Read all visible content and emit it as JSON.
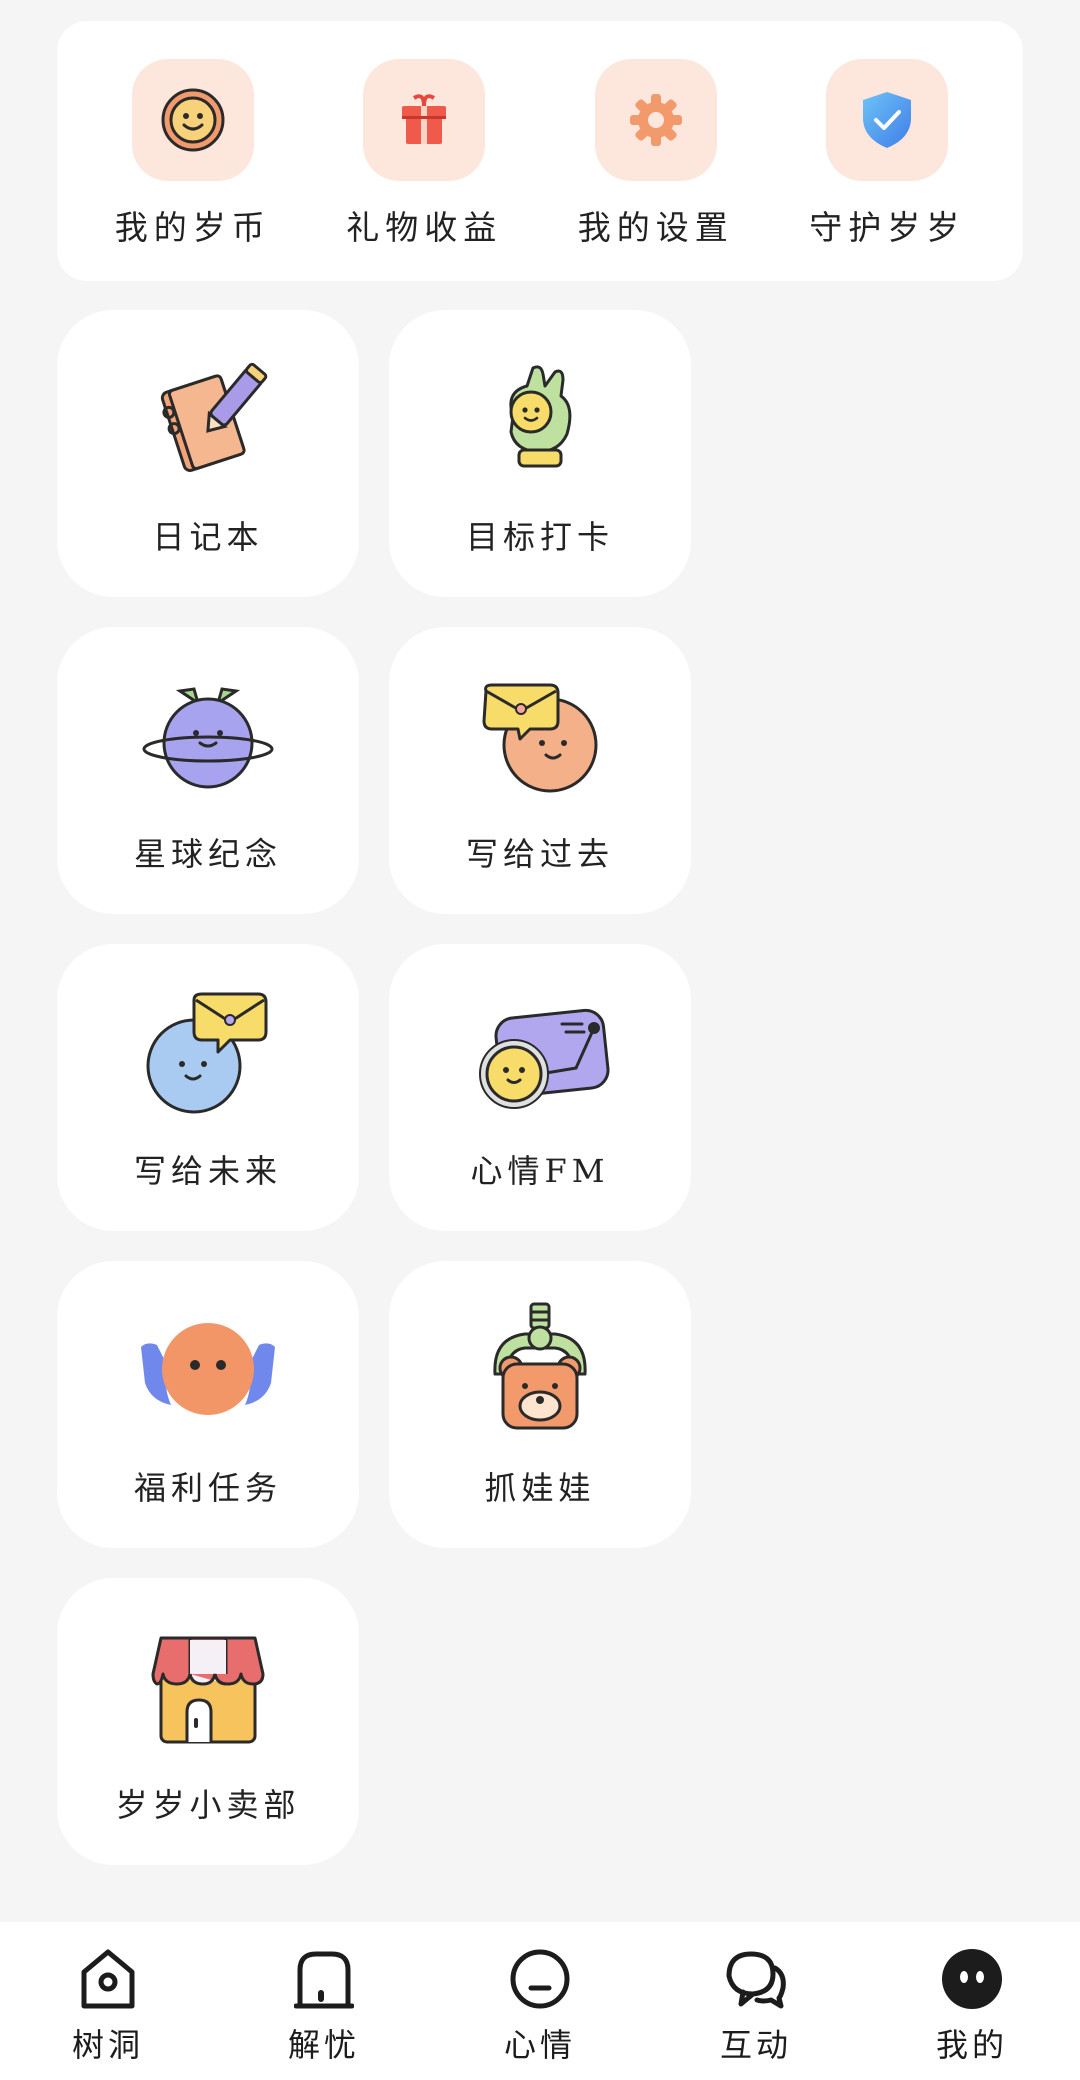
{
  "quick_panel": {
    "items": [
      {
        "label": "我的岁币",
        "icon": "smiley-coin-icon"
      },
      {
        "label": "礼物收益",
        "icon": "gift-icon"
      },
      {
        "label": "我的设置",
        "icon": "gear-icon"
      },
      {
        "label": "守护岁岁",
        "icon": "shield-check-icon"
      }
    ],
    "icon_bg_color": "#fde7dc"
  },
  "features": [
    {
      "label": "日记本",
      "icon": "notebook-pencil-icon"
    },
    {
      "label": "目标打卡",
      "icon": "ok-hand-icon"
    },
    {
      "label": "星球纪念",
      "icon": "planet-icon"
    },
    {
      "label": "写给过去",
      "icon": "envelope-face-orange-icon"
    },
    {
      "label": "写给未来",
      "icon": "envelope-face-blue-icon"
    },
    {
      "label": "心情FM",
      "icon": "radio-icon"
    },
    {
      "label": "福利任务",
      "icon": "winged-face-icon"
    },
    {
      "label": "抓娃娃",
      "icon": "claw-bear-icon"
    },
    {
      "label": "岁岁小卖部",
      "icon": "shop-icon"
    }
  ],
  "bottom_nav": {
    "items": [
      {
        "label": "树洞",
        "icon": "treehole-home-icon"
      },
      {
        "label": "解忧",
        "icon": "door-icon"
      },
      {
        "label": "心情",
        "icon": "neutral-face-icon"
      },
      {
        "label": "互动",
        "icon": "chat-bubbles-icon"
      },
      {
        "label": "我的",
        "icon": "profile-face-icon",
        "active": true
      }
    ]
  },
  "colors": {
    "background": "#f5f5f5",
    "card": "#ffffff",
    "accent_orange": "#f0a07a",
    "text": "#222222"
  }
}
